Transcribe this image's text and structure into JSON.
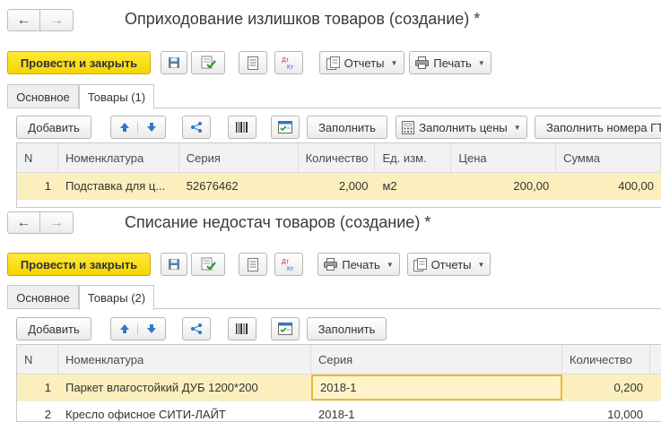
{
  "forms": [
    {
      "title": "Оприходование излишков товаров (создание) *",
      "toolbar": {
        "post_close": "Провести и закрыть",
        "menus": [
          "Отчеты",
          "Печать"
        ]
      },
      "tabs": [
        "Основное",
        "Товары (1)"
      ],
      "table_toolbar": {
        "add": "Добавить",
        "fill": "Заполнить",
        "fill_prices": "Заполнить цены",
        "fill_gtd": "Заполнить номера ГТ"
      },
      "table": {
        "columns": [
          "N",
          "Номенклатура",
          "Серия",
          "Количество",
          "Ед. изм.",
          "Цена",
          "Сумма"
        ],
        "rows": [
          [
            "1",
            "Подставка для ц...",
            "52676462",
            "2,000",
            "м2",
            "200,00",
            "400,00"
          ]
        ]
      }
    },
    {
      "title": "Списание недостач товаров (создание) *",
      "toolbar": {
        "post_close": "Провести и закрыть",
        "menus": [
          "Печать",
          "Отчеты"
        ]
      },
      "tabs": [
        "Основное",
        "Товары (2)"
      ],
      "table_toolbar": {
        "add": "Добавить",
        "fill": "Заполнить"
      },
      "table": {
        "columns": [
          "N",
          "Номенклатура",
          "Серия",
          "Количество"
        ],
        "rows": [
          [
            "1",
            "Паркет влагостойкий ДУБ 1200*200",
            "2018-1",
            "0,200"
          ],
          [
            "2",
            "Кресло офисное СИТИ-ЛАЙТ",
            "2018-1",
            "10,000"
          ]
        ]
      }
    }
  ],
  "icons": {
    "back": "arrow-left-icon",
    "forward": "arrow-right-icon",
    "save": "floppy-disk-icon",
    "post": "post-document-icon",
    "structure": "document-list-icon",
    "dt_kt": "dt-kt-icon",
    "reports": "reports-icon",
    "print": "printer-icon",
    "move_up": "arrow-up-icon",
    "move_down": "arrow-down-icon",
    "share": "share-icon",
    "barcode": "barcode-icon",
    "select": "checklist-icon",
    "fill_prices": "calculator-icon"
  },
  "colors": {
    "primary_button": "#f5d400",
    "selected_row": "#fbefbe",
    "current_cell_border": "#e8b93b"
  },
  "glyphs": {
    "back": "←",
    "forward": "→",
    "dropdown": "▼"
  }
}
